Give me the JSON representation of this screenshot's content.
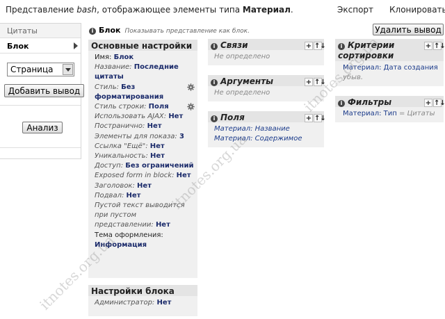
{
  "header": {
    "title_prefix": "Представление ",
    "view_name": "bash",
    "title_middle": ", отображающее элементы типа ",
    "node_type": "Материал",
    "title_suffix": ".",
    "export_link": "Экспорт",
    "clone_link": "Клонировать"
  },
  "sidebar": {
    "tabs": [
      "Цитаты",
      "Блок"
    ],
    "display_select": "Страница",
    "add_display_button": "Добавить вывод",
    "analyze_button": "Анализ"
  },
  "display": {
    "name": "Блок",
    "description": "Показывать представление как блок.",
    "remove_button": "Удалить вывод"
  },
  "basic_settings": {
    "title": "Основные настройки",
    "rows": [
      {
        "label": "Имя:",
        "value": "Блок",
        "normal_label": true
      },
      {
        "label": "Название:",
        "value": "Последние цитаты"
      },
      {
        "label": "Стиль:",
        "value": "Без форматирования",
        "gear": true
      },
      {
        "label": "Стиль строки:",
        "value": "Поля",
        "gear": true
      },
      {
        "label": "Использовать AJAX:",
        "value": "Нет"
      },
      {
        "label": "Постранично:",
        "value": "Нет"
      },
      {
        "label": "Элементы для показа:",
        "value": "3"
      },
      {
        "label": "Ссылка \"Ещё\":",
        "value": "Нет"
      },
      {
        "label": "Уникальность:",
        "value": "Нет"
      },
      {
        "label": "Доступ:",
        "value": "Без ограничений"
      },
      {
        "label": "Exposed form in block:",
        "value": "Нет"
      },
      {
        "label": "Заголовок:",
        "value": "Нет"
      },
      {
        "label": "Подвал:",
        "value": "Нет"
      },
      {
        "label": "Пустой текст выводится при пустом представлении:",
        "value": "Нет"
      },
      {
        "label": "Тема оформления:",
        "value": "Информация",
        "normal_label": true
      }
    ]
  },
  "block_settings": {
    "title": "Настройки блока",
    "rows": [
      {
        "label": "Администратор:",
        "value": "Нет"
      }
    ]
  },
  "relationships": {
    "title": "Связи",
    "empty": "Не определено"
  },
  "arguments": {
    "title": "Аргументы",
    "empty": "Не определено"
  },
  "fields": {
    "title": "Поля",
    "items": [
      "Материал: Название",
      "Материал: Содержимое"
    ]
  },
  "sort": {
    "title": "Критерии сортировки",
    "item_label": "Материал: Дата создания",
    "item_suffix": "убыв."
  },
  "filters": {
    "title": "Фильтры",
    "item_label": "Материал: Тип",
    "item_value": "= Цитаты"
  },
  "controls": {
    "add": "+",
    "rearrange": "↑↓"
  },
  "watermark": "itnotes.org.ua"
}
